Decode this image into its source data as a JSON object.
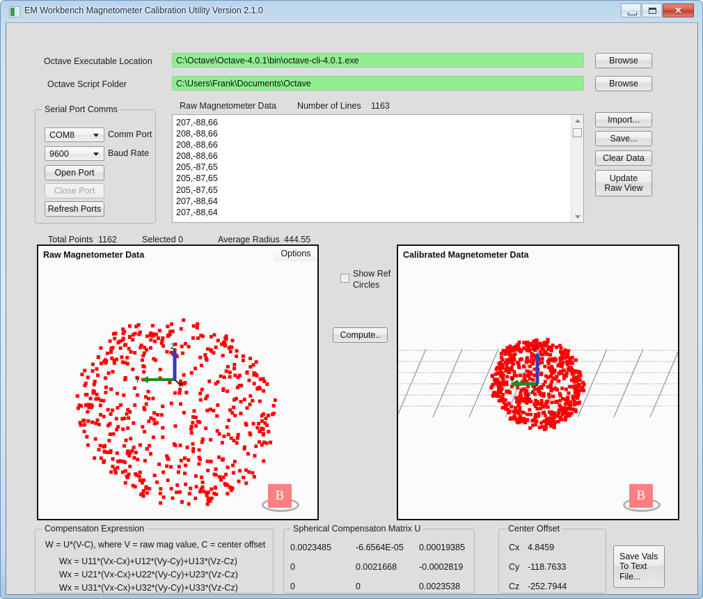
{
  "window": {
    "title": "EM Workbench Magnetometer Calibration Utility Version 2.1.0",
    "icon": "app-icon",
    "minimize_label": "",
    "maximize_label": "",
    "close_label": "✕"
  },
  "paths": {
    "octave_exe_label": "Octave Executable Location",
    "octave_exe_value": "C:\\Octave\\Octave-4.0.1\\bin\\octave-cli-4.0.1.exe",
    "octave_script_label": "Octave Script Folder",
    "octave_script_value": "C:\\Users\\Frank\\Documents\\Octave",
    "browse_exe_label": "Browse",
    "browse_script_label": "Browse",
    "field_color": "#90ee90"
  },
  "serial": {
    "group_title": "Serial Port Comms",
    "comm_port_value": "COM8",
    "comm_port_label": "Comm Port",
    "baud_rate_value": "9600",
    "baud_rate_label": "Baud Rate",
    "open_port_label": "Open Port",
    "close_port_label": "Close Port",
    "refresh_ports_label": "Refresh Ports",
    "comm_port_options": [
      "COM8"
    ],
    "baud_rate_options": [
      "9600"
    ]
  },
  "rawdata": {
    "header_label": "Raw Magnetometer Data",
    "lines_label": "Number of Lines",
    "lines_value": "1163",
    "lines": [
      "207,-88,66",
      "208,-88,66",
      "208,-88,66",
      "208,-88,66",
      "205,-87,65",
      "205,-87,65",
      "205,-87,65",
      "207,-88,64",
      "207,-88,64"
    ]
  },
  "actions": {
    "import_label": "Import...",
    "save_label": "Save...",
    "clear_label": "Clear Data",
    "update_raw_label": "Update\nRaw View",
    "update_raw_line1": "Update",
    "update_raw_line2": "Raw View"
  },
  "stats": {
    "total_points_label": "Total Points",
    "total_points_value": "1162",
    "selected_label": "Selected 0",
    "avg_radius_label": "Average Radius",
    "avg_radius_value": "444.55"
  },
  "plots": {
    "raw_title": "Raw Magnetometer Data",
    "raw_options_label": "Options",
    "calibrated_title": "Calibrated Magnetometer Data",
    "axis_x": "X",
    "axis_y": "Y",
    "axis_z": "Z",
    "brand_letter": "B",
    "point_color": "#ff0000"
  },
  "middle": {
    "show_ref_line1": "Show Ref",
    "show_ref_line2": "Circles",
    "show_ref_checked": false,
    "compute_label": "Compute.."
  },
  "compensation": {
    "group_title": "Compensaton Expression",
    "lines": [
      "W = U*(V-C), where V = raw mag value, C = center offset",
      "Wx = U11*(Vx-Cx)+U12*(Vy-Cy)+U13*(Vz-Cz)",
      "Wx = U21*(Vx-Cx)+U22*(Vy-Cy)+U23*(Vz-Cz)",
      "Wx = U31*(Vx-Cx)+U32*(Vy-Cy)+U33*(Vz-Cz)"
    ]
  },
  "matrix": {
    "group_title": "Spherical Compensaton Matrix U",
    "rows": [
      [
        "0.0023485",
        "-6.6564E-05",
        "0.00019385"
      ],
      [
        "0",
        "0.0021668",
        "-0.0002819"
      ],
      [
        "0",
        "0",
        "0.0023538"
      ]
    ]
  },
  "center_offset": {
    "group_title": "Center Offset",
    "cx_label": "Cx",
    "cx_value": "4.8459",
    "cy_label": "Cy",
    "cy_value": "-118.7633",
    "cz_label": "Cz",
    "cz_value": "-252.7944"
  },
  "save_vals": {
    "line1": "Save Vals",
    "line2": "To Text",
    "line3": "File..."
  }
}
